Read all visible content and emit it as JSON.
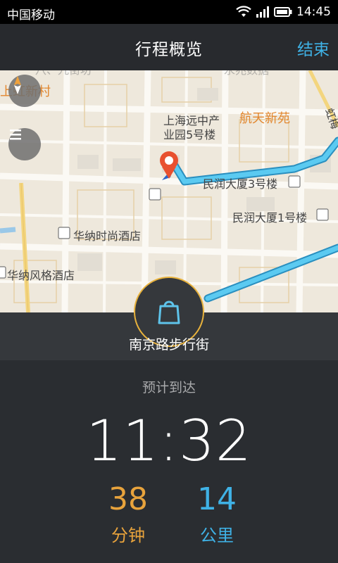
{
  "status_bar": {
    "carrier": "中国移动",
    "time": "14:45"
  },
  "header": {
    "title": "行程概览",
    "end_label": "结束"
  },
  "map": {
    "labels": {
      "top_left_district": "上虹新村",
      "top_faded_1": "八、九街坊",
      "top_faded_2": "永兆数据",
      "park_line1": "上海远中产",
      "park_line2": "业园5号楼",
      "hangtian": "航天新苑",
      "minrun3": "民润大厦3号楼",
      "minrun1": "民润大厦1号楼",
      "huana_fashion": "华纳时尚酒店",
      "huana_style": "华纳风格酒店",
      "road_right": "虹梅"
    }
  },
  "destination": {
    "name": "南京路步行街"
  },
  "eta": {
    "label": "预计到达",
    "time": "11:32"
  },
  "stats": {
    "minutes": {
      "value": "38",
      "unit": "分钟"
    },
    "distance": {
      "value": "14",
      "unit": "公里"
    }
  },
  "colors": {
    "accent_blue": "#3fb2e6",
    "accent_orange": "#e8a33c",
    "route": "#3ab6e6"
  }
}
